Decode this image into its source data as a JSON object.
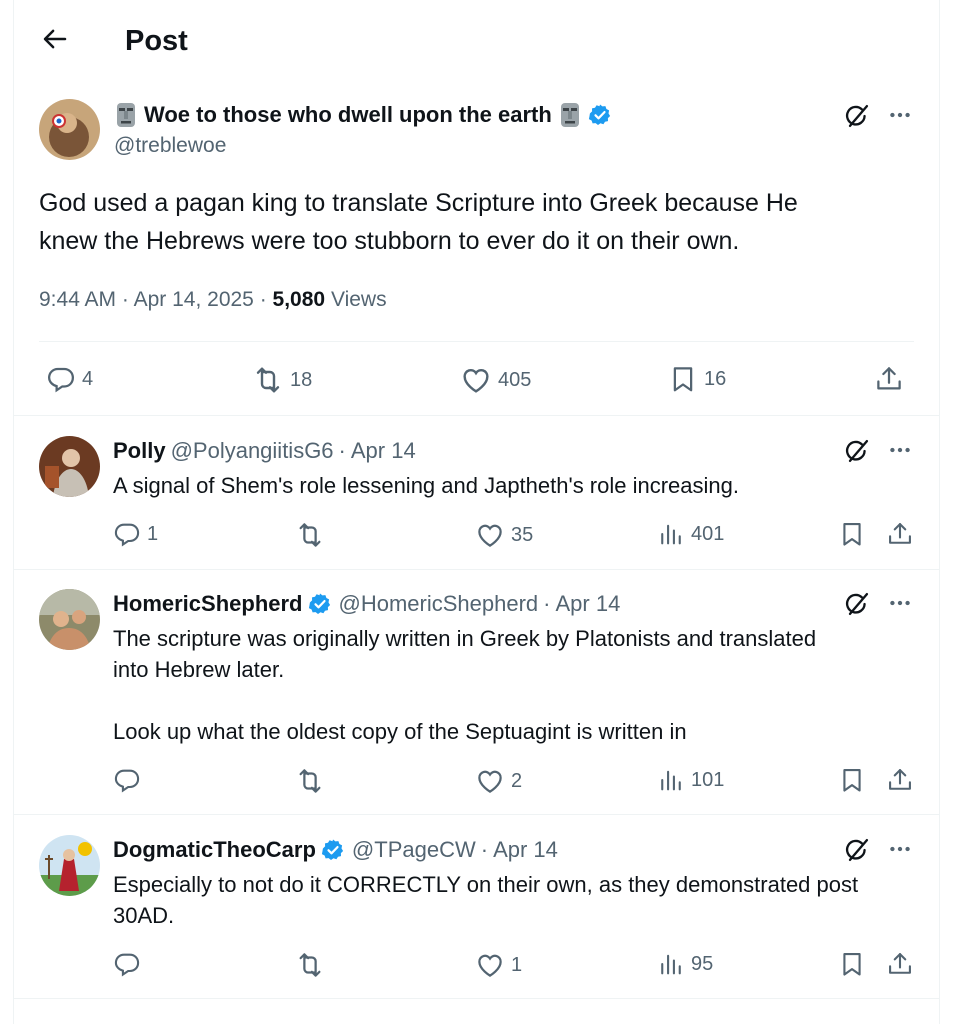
{
  "header": {
    "title": "Post"
  },
  "main_post": {
    "display_name": "Woe to those who dwell upon the earth",
    "handle": "@treblewoe",
    "text_line1": "God used a pagan king to translate Scripture into Greek because He",
    "text_line2": "knew the Hebrews were too stubborn to ever do it on their own.",
    "time": "9:44 AM",
    "date": "Apr 14, 2025",
    "views_count": "5,080",
    "views_label": "Views",
    "replies": "4",
    "reposts": "18",
    "likes": "405",
    "bookmarks": "16"
  },
  "replies": [
    {
      "display_name": "Polly",
      "handle": "@PolyangiitisG6",
      "date": "Apr 14",
      "lines": [
        "A signal of Shem's role lessening and Japtheth's role increasing."
      ],
      "replies": "1",
      "reposts": "",
      "likes": "35",
      "views": "401"
    },
    {
      "display_name": "HomericShepherd",
      "handle": "@HomericShepherd",
      "date": "Apr 14",
      "lines": [
        "The scripture was originally written in Greek by Platonists and translated",
        "into Hebrew later.",
        "Look up what the oldest copy of the Septuagint is written in"
      ],
      "replies": "",
      "reposts": "",
      "likes": "2",
      "views": "101"
    },
    {
      "display_name": "DogmaticTheoCarp",
      "handle": "@TPageCW",
      "date": "Apr 14",
      "lines": [
        "Especially to not do it CORRECTLY on their own, as they demonstrated post",
        "30AD."
      ],
      "replies": "",
      "reposts": "",
      "likes": "1",
      "views": "95"
    }
  ],
  "separator": "·",
  "icons": {
    "back": "arrow-left-icon",
    "verified": "verified-badge-icon",
    "grok": "grok-icon",
    "more": "more-icon",
    "reply": "reply-icon",
    "repost": "repost-icon",
    "like": "heart-icon",
    "bookmark": "bookmark-icon",
    "share": "share-icon",
    "views": "views-icon"
  },
  "colors": {
    "verified": "#1d9bf0",
    "muted": "#536471",
    "text": "#0f1419"
  }
}
